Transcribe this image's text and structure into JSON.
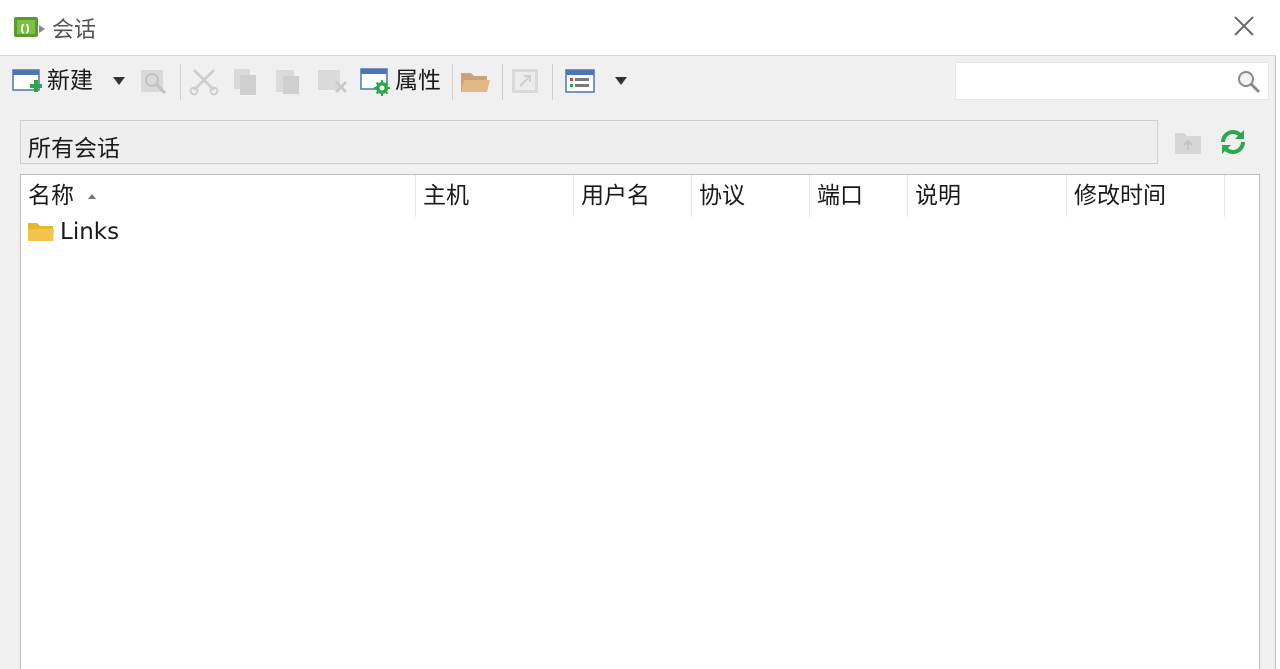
{
  "window": {
    "title": "会话"
  },
  "toolbar": {
    "new_label": "新建",
    "properties_label": "属性"
  },
  "search": {
    "value": "",
    "placeholder": ""
  },
  "path_bar": {
    "label": "所有会话"
  },
  "table": {
    "columns": [
      "名称",
      "主机",
      "用户名",
      "协议",
      "端口",
      "说明",
      "修改时间"
    ],
    "sort_column": "名称",
    "rows": [
      {
        "name": "Links",
        "type": "folder"
      }
    ]
  },
  "colors": {
    "toolbar_bg": "#f0f0f0",
    "folder_yellow": "#f4c24e",
    "refresh_green": "#2aa84a"
  }
}
